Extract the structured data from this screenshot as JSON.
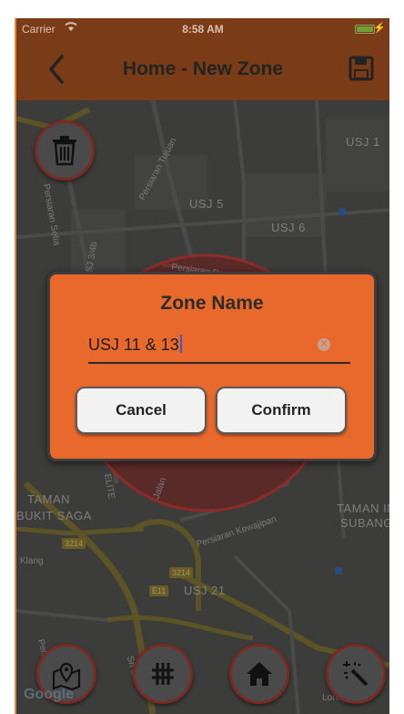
{
  "status_bar": {
    "carrier": "Carrier",
    "time": "8:58 AM"
  },
  "nav": {
    "title": "Home - New Zone",
    "back_icon": "chevron-left-icon",
    "save_icon": "floppy-disk-icon"
  },
  "map": {
    "labels": [
      "USJ 1",
      "USJ 5",
      "USJ 6",
      "TAMAN",
      "BUKIT SAGA",
      "TAMAN INC",
      "SUBANG U",
      "USJ 21"
    ],
    "roads": [
      "Persiaran Tujuan",
      "Persiaran Setia",
      "USJ 3/4b",
      "Persiaran Perpaduan",
      "Persiaran Kewajipan",
      "Jalan",
      "Klang",
      "Lorong 2",
      "ELITE",
      "Persiaran Kasih",
      "Sri Seri"
    ],
    "badges": [
      "3214",
      "3214",
      "E11"
    ],
    "google": "Google",
    "zone_color": "#8e2a28"
  },
  "dialog": {
    "title": "Zone Name",
    "input_value": "USJ 11 & 13",
    "cancel_label": "Cancel",
    "confirm_label": "Confirm",
    "accent": "#e9692d"
  },
  "buttons": {
    "delete_icon": "trash-icon",
    "bottom": [
      "map-pin-icon",
      "grid-icon",
      "home-icon",
      "magic-wand-icon"
    ]
  }
}
